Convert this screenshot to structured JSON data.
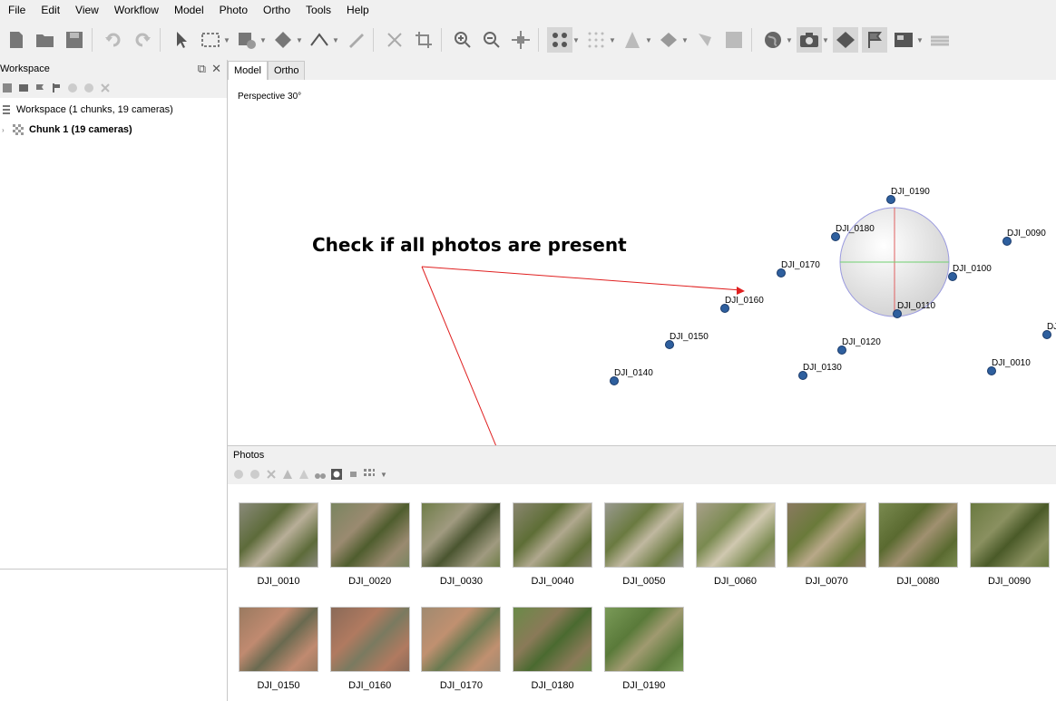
{
  "menu": [
    "File",
    "Edit",
    "View",
    "Workflow",
    "Model",
    "Photo",
    "Ortho",
    "Tools",
    "Help"
  ],
  "workspace": {
    "title": "Workspace",
    "root_label": "Workspace (1 chunks, 19 cameras)",
    "chunk_label": "Chunk 1 (19 cameras)"
  },
  "tabs": [
    "Model",
    "Ortho"
  ],
  "view": {
    "perspective_label": "Perspective 30°",
    "annotation": "Check if all photos are present",
    "cameras": [
      {
        "label": "DJI_0190"
      },
      {
        "label": "DJI_0180"
      },
      {
        "label": "DJI_0090"
      },
      {
        "label": "DJI_0170"
      },
      {
        "label": "DJI_0100"
      },
      {
        "label": "DJI_0160"
      },
      {
        "label": "DJI_0110"
      },
      {
        "label": "DJI_0150"
      },
      {
        "label": "DJI_0120"
      },
      {
        "label": "DJI_0140"
      },
      {
        "label": "DJI_0130"
      },
      {
        "label": "DJI_0010"
      },
      {
        "label": "DJ"
      }
    ]
  },
  "photos": {
    "title": "Photos",
    "items": [
      "DJI_0010",
      "DJI_0020",
      "DJI_0030",
      "DJI_0040",
      "DJI_0050",
      "DJI_0060",
      "DJI_0070",
      "DJI_0080",
      "DJI_0090",
      "DJI_0150",
      "DJI_0160",
      "DJI_0170",
      "DJI_0180",
      "DJI_0190"
    ]
  },
  "colors": {
    "camera": "#2e5f9e",
    "annotation_arrow": "#e02020"
  }
}
